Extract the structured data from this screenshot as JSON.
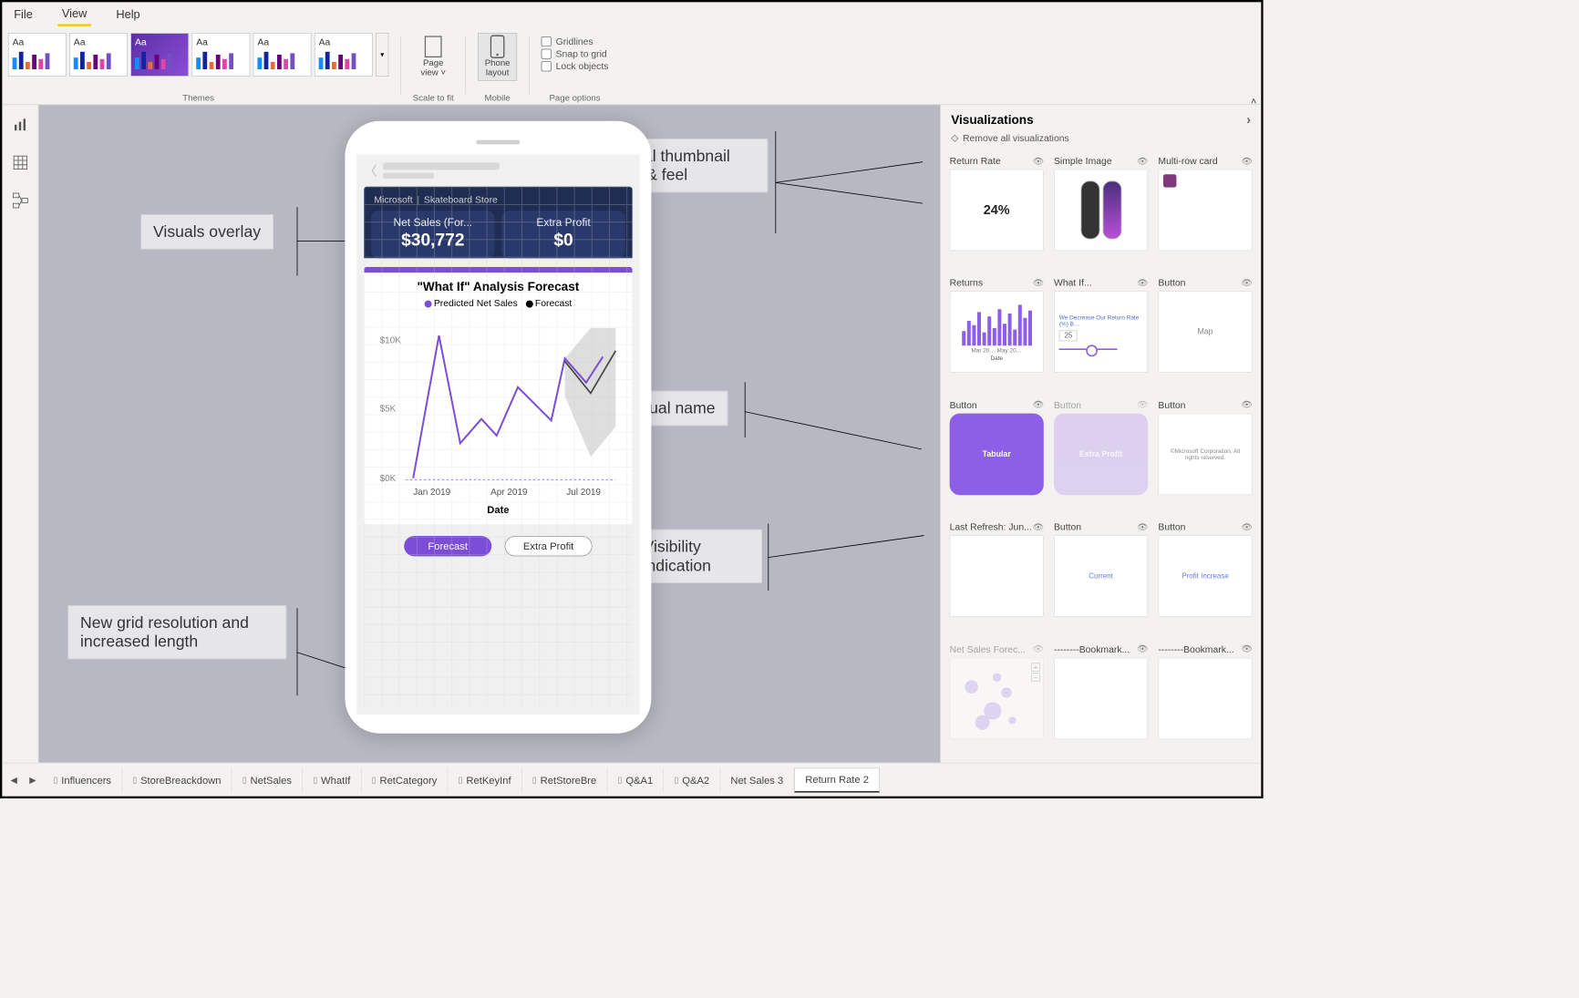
{
  "menubar": {
    "items": [
      "File",
      "View",
      "Help"
    ],
    "active": "View"
  },
  "ribbon": {
    "themes_label": "Themes",
    "theme_sample_text": "Aa",
    "scale_group_label": "Scale to fit",
    "page_view_label": "Page view ˅",
    "mobile_group_label": "Mobile",
    "phone_layout_label": "Phone layout",
    "page_options_label": "Page options",
    "opt_gridlines": "Gridlines",
    "opt_snap": "Snap to grid",
    "opt_lock": "Lock objects"
  },
  "callouts": {
    "visuals_overlay": "Visuals overlay",
    "thumbnail_look": "Visual thumbnail look & feel",
    "visual_name": "Visual name",
    "visibility_indication": "Visibility indication",
    "grid_resolution": "New grid resolution and increased length"
  },
  "phone": {
    "brand_left": "Microsoft",
    "brand_right": "Skateboard Store",
    "kpi1_label": "Net Sales (For...",
    "kpi1_value": "$30,772",
    "kpi2_label": "Extra Profit",
    "kpi2_value": "$0",
    "chart_title": "\"What If\" Analysis Forecast",
    "legend_predicted": "Predicted Net Sales",
    "legend_forecast": "Forecast",
    "xaxis_label": "Date",
    "pill_forecast": "Forecast",
    "pill_extra": "Extra Profit"
  },
  "chart_data": {
    "type": "line",
    "title": "\"What If\" Analysis Forecast",
    "xlabel": "Date",
    "ylabel": "",
    "ylim": [
      0,
      11000
    ],
    "y_ticks": [
      "$0K",
      "$5K",
      "$10K"
    ],
    "x_ticks": [
      "Jan 2019",
      "Apr 2019",
      "Jul 2019"
    ],
    "series": [
      {
        "name": "Predicted Net Sales",
        "color": "#7c4dd6",
        "x": [
          "Jan",
          "Feb",
          "Mar",
          "Apr",
          "May",
          "Jun",
          "Jul",
          "Aug"
        ],
        "values": [
          200,
          9800,
          2600,
          4200,
          3000,
          6400,
          5200,
          8600
        ]
      },
      {
        "name": "Forecast",
        "color": "#555555",
        "x": [
          "Jul",
          "Aug",
          "Sep"
        ],
        "values": [
          8200,
          7200,
          9200
        ],
        "band_low": [
          5000,
          3000,
          4500
        ],
        "band_high": [
          10500,
          11000,
          11000
        ]
      }
    ]
  },
  "viz_pane": {
    "title": "Visualizations",
    "remove_all": "Remove all visualizations",
    "items": [
      {
        "name": "Return Rate",
        "thumb": "24%",
        "kind": "text",
        "placed": false
      },
      {
        "name": "Simple Image",
        "thumb": "",
        "kind": "skate",
        "placed": false
      },
      {
        "name": "Multi-row card",
        "thumb": "",
        "kind": "card",
        "placed": false
      },
      {
        "name": "Returns",
        "thumb": "",
        "kind": "bars",
        "placed": false,
        "footer": "Mar 20…  May 20…",
        "footer2": "Date"
      },
      {
        "name": "What If...",
        "thumb": "25",
        "kind": "slider",
        "placed": false,
        "header": "We Decrease Our Return Rate (%) B…"
      },
      {
        "name": "Button",
        "thumb": "Map",
        "kind": "label",
        "placed": false
      },
      {
        "name": "Button",
        "thumb": "Tabular",
        "kind": "purple",
        "placed": false
      },
      {
        "name": "Button",
        "thumb": "Extra Profit",
        "kind": "lightpurple",
        "placed": true
      },
      {
        "name": "Button",
        "thumb": "©Microsoft Corporation. All rights reserved.",
        "kind": "smalltext",
        "placed": false
      },
      {
        "name": "Last Refresh: Jun...",
        "thumb": "",
        "kind": "blank",
        "placed": false
      },
      {
        "name": "Button",
        "thumb": "Current",
        "kind": "linklabel",
        "placed": false
      },
      {
        "name": "Button",
        "thumb": "Profit Increase",
        "kind": "linklabel",
        "placed": false
      },
      {
        "name": "Net Sales Forec...",
        "thumb": "",
        "kind": "map",
        "placed": true
      },
      {
        "name": "--------Bookmark...",
        "thumb": "",
        "kind": "blank",
        "placed": false
      },
      {
        "name": "--------Bookmark...",
        "thumb": "",
        "kind": "blank",
        "placed": false
      }
    ]
  },
  "tabs": {
    "items": [
      "Influencers",
      "StoreBreackdown",
      "NetSales",
      "WhatIf",
      "RetCategory",
      "RetKeyInf",
      "RetStoreBre",
      "Q&A1",
      "Q&A2",
      "Net Sales 3",
      "Return Rate 2"
    ],
    "active": "Return Rate 2"
  }
}
